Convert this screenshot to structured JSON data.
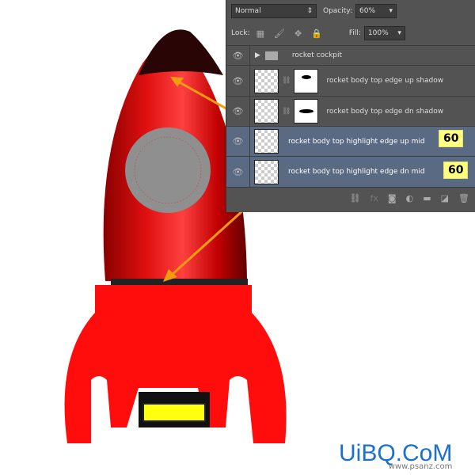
{
  "layers_panel": {
    "blend_mode": "Normal",
    "opacity_label": "Opacity:",
    "opacity_value": "60%",
    "lock_label": "Lock:",
    "fill_label": "Fill:",
    "fill_value": "100%",
    "layers": [
      {
        "name": "rocket cockpit",
        "type": "group",
        "visible": true
      },
      {
        "name": "rocket body top edge up shadow",
        "visible": true,
        "has_mask": true
      },
      {
        "name": "rocket body top edge dn shadow",
        "visible": true,
        "has_mask": true
      },
      {
        "name": "rocket body top highlight edge up mid",
        "visible": true,
        "selected": true,
        "badge": "60"
      },
      {
        "name": "rocket body top highlight edge dn mid",
        "visible": true,
        "selected": true,
        "badge": "60"
      }
    ],
    "toolbar_icons": [
      "link-icon",
      "fx-icon",
      "mask-icon",
      "adjustment-icon",
      "folder-icon",
      "new-layer-icon",
      "trash-icon"
    ]
  },
  "colors": {
    "rocket": "#e8141c",
    "arrow": "#f39c12",
    "selection": "#596a82",
    "badge": "#ffff80"
  },
  "watermark": {
    "logo": "UiBQ.CoM",
    "url": "www.psanz.com"
  }
}
